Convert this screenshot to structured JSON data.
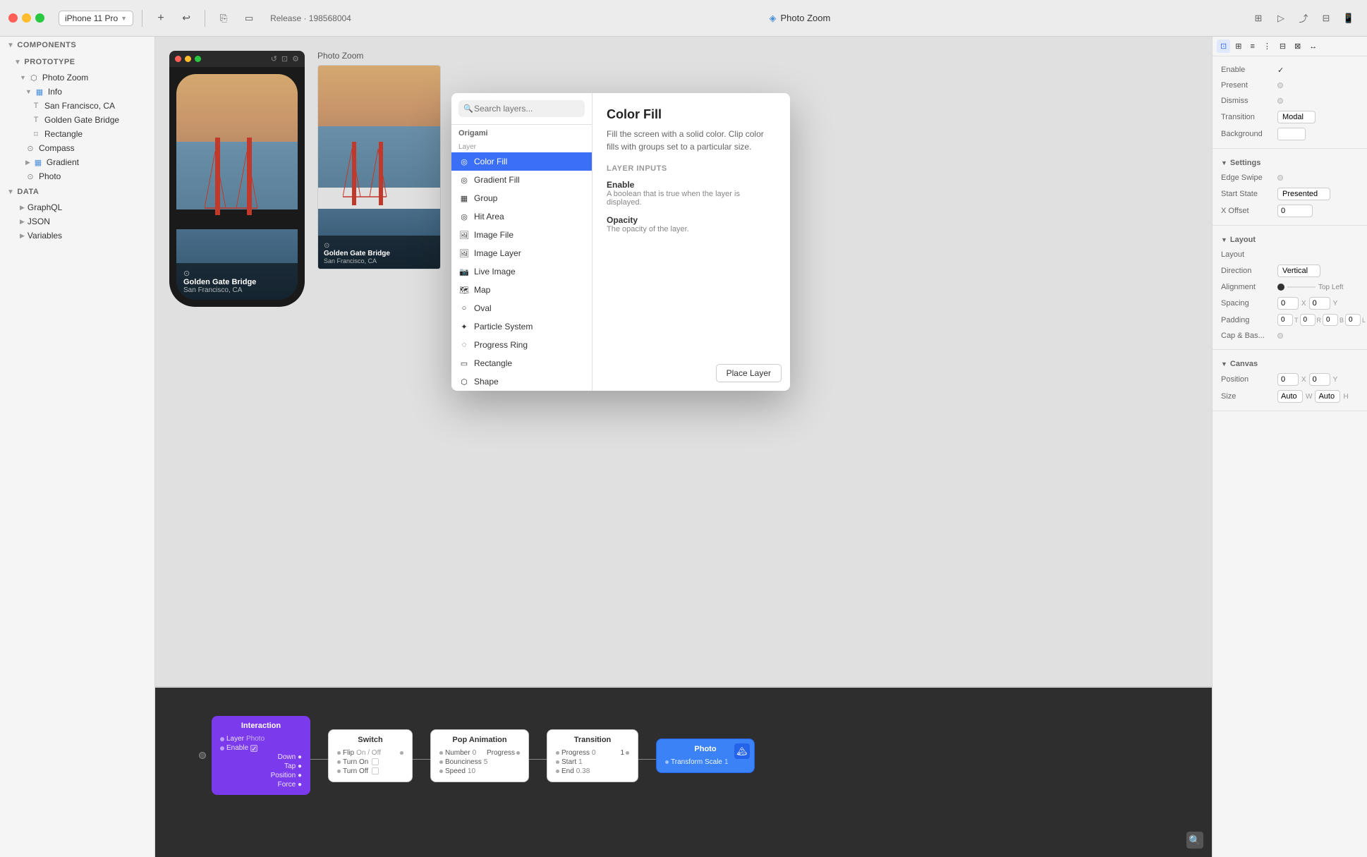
{
  "titlebar": {
    "device": "iPhone 11 Pro",
    "branch": "Release · 198568004",
    "app_title": "Photo Zoom",
    "add_btn": "+",
    "back_btn": "↩"
  },
  "sidebar": {
    "components_label": "COMPONENTS",
    "prototype_label": "PROTOTYPE",
    "photo_zoom_label": "Photo Zoom",
    "info_label": "Info",
    "san_francisco_label": "San Francisco, CA",
    "golden_gate_label": "Golden Gate Bridge",
    "rectangle_label": "Rectangle",
    "compass_label": "Compass",
    "gradient_label": "Gradient",
    "photo_label": "Photo",
    "data_label": "DATA",
    "graphql_label": "GraphQL",
    "json_label": "JSON",
    "variables_label": "Variables"
  },
  "preview": {
    "label": "Photo Zoom"
  },
  "layer_picker": {
    "search_placeholder": "Search layers...",
    "category": "Origami",
    "sub_category": "Layer",
    "items": [
      {
        "label": "Color Fill",
        "icon": "circle"
      },
      {
        "label": "Gradient Fill",
        "icon": "circle"
      },
      {
        "label": "Group",
        "icon": "square"
      },
      {
        "label": "Hit Area",
        "icon": "circle"
      },
      {
        "label": "Image File",
        "icon": "image"
      },
      {
        "label": "Image Layer",
        "icon": "image"
      },
      {
        "label": "Live Image",
        "icon": "camera"
      },
      {
        "label": "Map",
        "icon": "map"
      },
      {
        "label": "Oval",
        "icon": "oval"
      },
      {
        "label": "Particle System",
        "icon": "particles"
      },
      {
        "label": "Progress Ring",
        "icon": "ring"
      },
      {
        "label": "Rectangle",
        "icon": "rect"
      },
      {
        "label": "Shape",
        "icon": "shape"
      }
    ],
    "active_item": "Color Fill",
    "detail_title": "Color Fill",
    "detail_desc": "Fill the screen with a solid color. Clip color fills with groups set to a particular size.",
    "inputs_title": "Layer Inputs",
    "input1_name": "Enable",
    "input1_desc": "A boolean that is true when the layer is displayed.",
    "input2_name": "Opacity",
    "input2_desc": "The opacity of the layer.",
    "place_btn": "Place Layer"
  },
  "right_panel": {
    "enable_label": "Enable",
    "enable_value": "✓",
    "present_label": "Present",
    "dismiss_label": "Dismiss",
    "transition_label": "Transition",
    "transition_value": "Modal",
    "background_label": "Background",
    "settings_label": "Settings",
    "edge_swipe_label": "Edge Swipe",
    "start_state_label": "Start State",
    "start_state_value": "Presented",
    "x_offset_label": "X Offset",
    "x_offset_value": "0",
    "layout_label": "Layout",
    "layout_sub_label": "Layout",
    "direction_label": "Direction",
    "direction_value": "Vertical",
    "alignment_label": "Alignment",
    "alignment_value": "Top Left",
    "spacing_label": "Spacing",
    "spacing_x": "0",
    "spacing_y": "0",
    "padding_label": "Padding",
    "padding_t": "0",
    "padding_r": "0",
    "padding_b": "0",
    "padding_l": "0",
    "padding_labels": [
      "T",
      "R",
      "B",
      "L"
    ],
    "cap_bas_label": "Cap & Bas...",
    "canvas_label": "Canvas",
    "position_label": "Position",
    "position_x": "0",
    "position_y": "0",
    "size_label": "Size",
    "size_w": "Auto",
    "size_h": "Auto"
  },
  "node_graph": {
    "interaction_title": "Interaction",
    "interaction_rows": [
      {
        "label": "Layer",
        "value": "Photo"
      },
      {
        "label": "Enable",
        "value": "✓",
        "has_check": true
      },
      {
        "label": "",
        "value": "Down"
      },
      {
        "label": "",
        "value": "Tap"
      },
      {
        "label": "Position",
        "value": ""
      },
      {
        "label": "",
        "value": "Force"
      }
    ],
    "switch_title": "Switch",
    "switch_rows": [
      {
        "label": "Flip",
        "value": "On / Off"
      },
      {
        "label": "Turn On",
        "value": ""
      },
      {
        "label": "Turn Off",
        "value": ""
      }
    ],
    "pop_title": "Pop Animation",
    "pop_rows": [
      {
        "label": "Number",
        "value": "0",
        "output": "Progress"
      },
      {
        "label": "Bounciness",
        "value": "5"
      },
      {
        "label": "Speed",
        "value": "10"
      }
    ],
    "transition_title": "Transition",
    "transition_rows": [
      {
        "label": "Progress",
        "value": "0",
        "output": "1"
      },
      {
        "label": "Start",
        "value": "1"
      },
      {
        "label": "End",
        "value": "0.38"
      }
    ],
    "photo_title": "Photo",
    "photo_rows": [
      {
        "label": "Transform Scale",
        "value": "1"
      }
    ]
  }
}
